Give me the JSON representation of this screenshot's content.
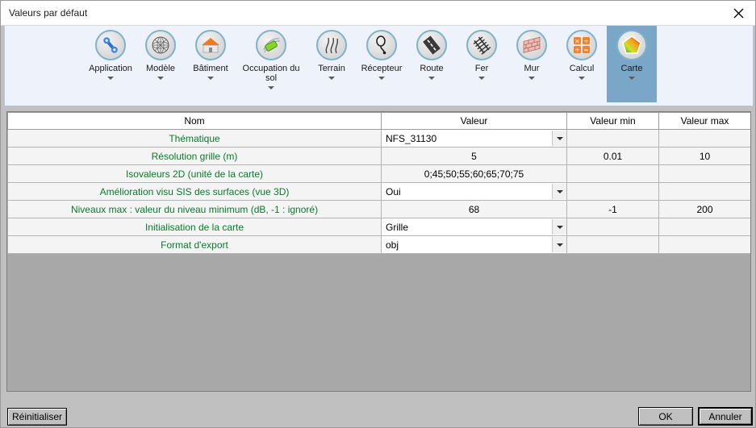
{
  "window": {
    "title": "Valeurs par défaut",
    "close_icon": "close-icon"
  },
  "ribbon": {
    "items": [
      {
        "label": "Application",
        "icon": "wrench-icon",
        "selected": false
      },
      {
        "label": "Modèle",
        "icon": "globe-mesh-icon",
        "selected": false
      },
      {
        "label": "Bâtiment",
        "icon": "house-icon",
        "selected": false
      },
      {
        "label": "Occupation du\nsol",
        "icon": "landuse-icon",
        "selected": false
      },
      {
        "label": "Terrain",
        "icon": "terrain-icon",
        "selected": false
      },
      {
        "label": "Récepteur",
        "icon": "receiver-icon",
        "selected": false
      },
      {
        "label": "Route",
        "icon": "road-icon",
        "selected": false
      },
      {
        "label": "Fer",
        "icon": "railway-icon",
        "selected": false
      },
      {
        "label": "Mur",
        "icon": "wall-icon",
        "selected": false
      },
      {
        "label": "Calcul",
        "icon": "calculator-icon",
        "selected": false
      },
      {
        "label": "Carte",
        "icon": "colormap-icon",
        "selected": true
      }
    ]
  },
  "grid": {
    "headers": [
      "Nom",
      "Valeur",
      "Valeur min",
      "Valeur max"
    ],
    "rows": [
      {
        "name": "Thématique",
        "value": "NFS_31130",
        "type": "combo",
        "min": "",
        "max": ""
      },
      {
        "name": "Résolution grille (m)",
        "value": "5",
        "type": "number",
        "min": "0.01",
        "max": "10"
      },
      {
        "name": "Isovaleurs 2D (unité de la carte)",
        "value": "0;45;50;55;60;65;70;75",
        "type": "number",
        "min": "",
        "max": ""
      },
      {
        "name": "Amélioration visu SIS des surfaces (vue 3D)",
        "value": "Oui",
        "type": "combo",
        "min": "",
        "max": ""
      },
      {
        "name": "Niveaux max : valeur du niveau minimum (dB, -1 : ignoré)",
        "value": "68",
        "type": "number",
        "min": "-1",
        "max": "200"
      },
      {
        "name": "Initialisation de la carte",
        "value": "Grille",
        "type": "combo",
        "min": "",
        "max": ""
      },
      {
        "name": "Format d'export",
        "value": "obj",
        "type": "combo",
        "min": "",
        "max": ""
      }
    ]
  },
  "footer": {
    "reset_label": "Réinitialiser",
    "ok_label": "OK",
    "cancel_label": "Annuler"
  },
  "colors": {
    "ribbon_bg": "#eef2fb",
    "selected_tab": "#7aa7c7",
    "name_text": "#0a7a2a",
    "dialog_bg": "#c0c0c0",
    "grid_filler": "#a8a8a8"
  }
}
